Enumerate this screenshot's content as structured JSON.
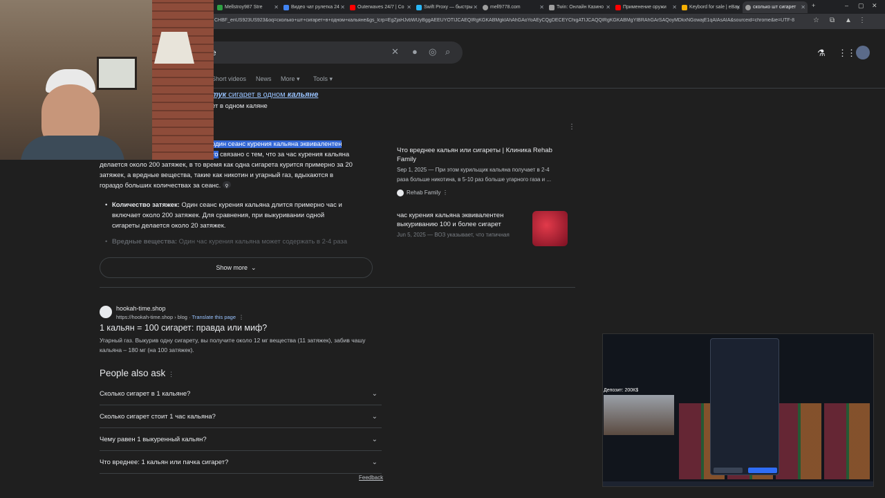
{
  "browser": {
    "tabs": [
      {
        "label": "Mellstroy987 Stre",
        "color": "#2ea043"
      },
      {
        "label": "Видео чат рулетка 24",
        "color": "#4285f4"
      },
      {
        "label": "Outerwaves 24/7 | Co",
        "color": "#ff0000"
      },
      {
        "label": "Swift Proxy — быстры",
        "color": "#29b6f6"
      },
      {
        "label": "mell9778.com",
        "color": "#9e9e9e"
      },
      {
        "label": "Twin: Онлайн Казино",
        "color": "#9e9e9e"
      },
      {
        "label": "Применение оружи",
        "color": "#ff0000"
      },
      {
        "label": "Keybord for sale | eBay",
        "color": "#f5af02"
      },
      {
        "label": "сколько шт сигарет",
        "color": "#9e9e9e"
      }
    ],
    "url": "CHBF_enUS923US923&oq=сколько+шт+сигарет+в+одном+кальяне&gs_lcrp=EgZjaHJvbWUyBggAEEUYOTIJCAEQIRgKGKABMgkIAhAhGAoYoAEyCQgDECEYChigATIJCAQQIRgKGKABMgYIBRAhGArSAQoyMDkxNGowajE1qAIAsAIA&sourceid=chrome&ie=UTF-8"
  },
  "search": {
    "query_tail": "е",
    "tabs": [
      "Short videos",
      "News",
      "More",
      "Tools"
    ]
  },
  "answer": {
    "corrected_prefix": "тук",
    "corrected_text": " сигарет в одном ",
    "corrected_word": "кальяне",
    "search_instead": "ет в одном каляне",
    "highlight1": "один сеанс курения кальяна эквивалентен",
    "highlight2": "то",
    "line2_rest": " связано с тем, что за час курения кальяна",
    "line3": "делается около 200 затяжек, в то время как одна сигарета курится примерно за 20",
    "line4": "затяжек, а вредные вещества, такие как никотин и угарный газ, вдыхаются в",
    "line5": "гораздо больших количествах за сеанс.",
    "bullet1_bold": "Количество затяжек:",
    "bullet1_line1": " Один сеанс курения кальяна длится примерно час и",
    "bullet1_line2": "включает около 200 затяжек. Для сравнения, при выкуривании одной",
    "bullet1_line3": "сигареты делается около 20 затяжек.",
    "bullet2_bold": "Вредные вещества:",
    "bullet2_line1": " Один час курения кальяна может содержать в 2-4 раза",
    "show_more": "Show more"
  },
  "sources": [
    {
      "title": "Что вреднее кальян или сигареты | Клиника Rehab Family",
      "snippet1": "Sep 1, 2025 — При этом курильщик кальяна получает в 2-4",
      "snippet2": "раза больше никотина, в 5-10 раз больше угарного газа и ...",
      "site": "Rehab Family"
    },
    {
      "title": "час курения кальяна эквивалентен выкуриванию 100 и более сигарет",
      "snippet1": "Jun 5, 2025 — ВОЗ указывает, что типичная"
    }
  ],
  "result": {
    "site": "hookah-time.shop",
    "cite": "https://hookah-time.shop › blog",
    "translate": "Translate this page",
    "title": "1 кальян = 100 сигарет: правда или миф?",
    "snippet1": "Угарный газ. Выкурив одну сигарету, вы получите около 12 мг вещества (11 затяжек), забив чашу",
    "snippet2": "кальяна – 180 мг (на 100 затяжек)."
  },
  "paa": {
    "heading": "People also ask",
    "questions": [
      "Сколько сигарет в 1 кальяне?",
      "Сколько сигарет стоит 1 час кальяна?",
      "Чему равен 1 выкуренный кальян?",
      "Что вреднее: 1 кальян или пачка сигарет?"
    ],
    "feedback": "Feedback"
  },
  "stream": {
    "deposit": "Депозит: 200К$"
  }
}
